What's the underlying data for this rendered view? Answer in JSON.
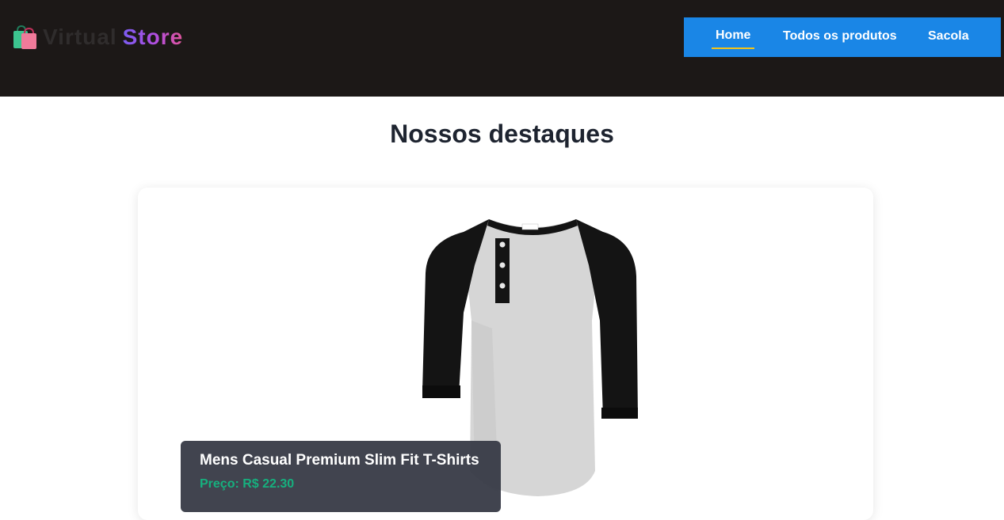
{
  "header": {
    "logo": {
      "icon": "shopping-bags-icon",
      "word1": "Virtual",
      "word2": "Store"
    },
    "nav": [
      {
        "label": "Home",
        "active": true
      },
      {
        "label": "Todos os produtos",
        "active": false
      },
      {
        "label": "Sacola",
        "active": false
      }
    ]
  },
  "main": {
    "title": "Nossos destaques",
    "featured": {
      "image": "henley-raglan-shirt-image",
      "name": "Mens Casual Premium Slim Fit T-Shirts",
      "price": "Preço: R$ 22.30"
    }
  },
  "colors": {
    "header_bg": "#1c1817",
    "nav_bg": "#1a86e6",
    "active_underline": "#f5c518",
    "price": "#16b07e"
  }
}
